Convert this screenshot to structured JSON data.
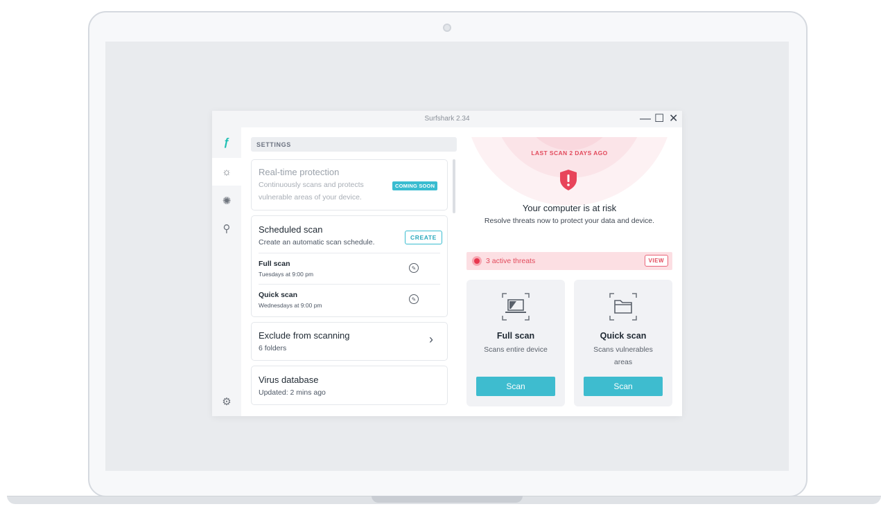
{
  "window": {
    "title": "Surfshark 2.34",
    "minimize_glyph": "—",
    "maximize_glyph": "☐",
    "close_glyph": "✕"
  },
  "sidebar": {
    "items": [
      {
        "icon": "surfshark-logo-icon",
        "glyph": "ƒ"
      },
      {
        "icon": "bug-icon",
        "glyph": "☼"
      },
      {
        "icon": "alert-bug-icon",
        "glyph": "✺"
      },
      {
        "icon": "search-zoom-icon",
        "glyph": "⚲"
      },
      {
        "icon": "gear-icon",
        "glyph": "⚙"
      }
    ]
  },
  "settings": {
    "header": "SETTINGS",
    "realtime": {
      "title": "Real-time protection",
      "subtitle_line1": "Continuously scans and protects",
      "subtitle_line2": "vulnerable areas of your device.",
      "badge": "COMING SOON"
    },
    "scheduled": {
      "title": "Scheduled scan",
      "subtitle": "Create an automatic scan schedule.",
      "create_label": "CREATE",
      "rows": [
        {
          "name": "Full scan",
          "when": "Tuesdays at 9:00 pm"
        },
        {
          "name": "Quick scan",
          "when": "Wednesdays at 9:00 pm"
        }
      ]
    },
    "exclude": {
      "title": "Exclude from scanning",
      "subtitle": "6 folders",
      "chevron": "›"
    },
    "virus_db": {
      "title": "Virus database",
      "subtitle": "Updated: 2 mins ago"
    }
  },
  "status": {
    "last_scan": "LAST SCAN 2 DAYS AGO",
    "title": "Your computer is at risk",
    "subtitle": "Resolve threats now to protect your data and device.",
    "threats_label": "3 active threats",
    "view_label": "VIEW",
    "colors": {
      "danger": "#e24a5c",
      "accent": "#3ebccf"
    }
  },
  "scans": [
    {
      "title": "Full scan",
      "subtitle": "Scans entire device",
      "button": "Scan",
      "icon": "laptop-icon"
    },
    {
      "title": "Quick scan",
      "subtitle": "Scans vulnerables areas",
      "button": "Scan",
      "icon": "folder-icon"
    }
  ]
}
